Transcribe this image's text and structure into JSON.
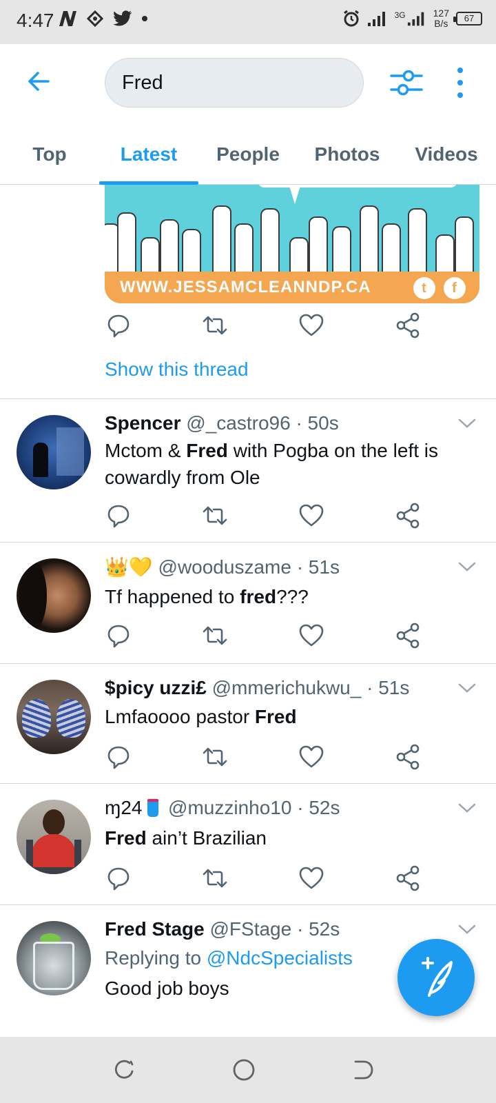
{
  "status_bar": {
    "time": "4:47",
    "speed_top": "127",
    "speed_bottom": "B/s",
    "network": "3G",
    "battery": "67"
  },
  "search": {
    "query": "Fred"
  },
  "tabs": [
    {
      "label": "Top",
      "active": false
    },
    {
      "label": "Latest",
      "active": true
    },
    {
      "label": "People",
      "active": false
    },
    {
      "label": "Photos",
      "active": false
    },
    {
      "label": "Videos",
      "active": false
    }
  ],
  "card": {
    "banner_text": "WWW.JESSAMCLEANNDP.CA"
  },
  "show_thread": "Show this thread",
  "tweets": [
    {
      "name": "Spencer",
      "handle": "@_castro96",
      "time": "· 50s",
      "body_pre": "Mctom & ",
      "body_bold": "Fred",
      "body_post": " with Pogba on the left is cowardly from Ole"
    },
    {
      "name": "👑💛",
      "handle": "@wooduszame",
      "time": "· 51s",
      "body_pre": "Tf happened to ",
      "body_bold": "fred",
      "body_post": "???"
    },
    {
      "name": "$picy uzzi£",
      "handle": "@mmerichukwu_",
      "time": "· 51s",
      "body_pre": "Lmfaoooo pastor ",
      "body_bold": "Fred",
      "body_post": ""
    },
    {
      "name": "ɱ24",
      "handle": "@muzzinho10",
      "time": "· 52s",
      "body_pre": "",
      "body_bold": "Fred",
      "body_post": " ain’t Brazilian"
    },
    {
      "name": "Fred Stage",
      "handle": "@FStage",
      "time": "· 52s",
      "reply_prefix": "Replying to ",
      "reply_mention": "@NdcSpecialists",
      "body_pre": "Good job boys",
      "body_bold": "",
      "body_post": ""
    }
  ],
  "colors": {
    "accent": "#1d9bf0",
    "secondary_text": "#536471",
    "divider": "#cfd9de"
  }
}
